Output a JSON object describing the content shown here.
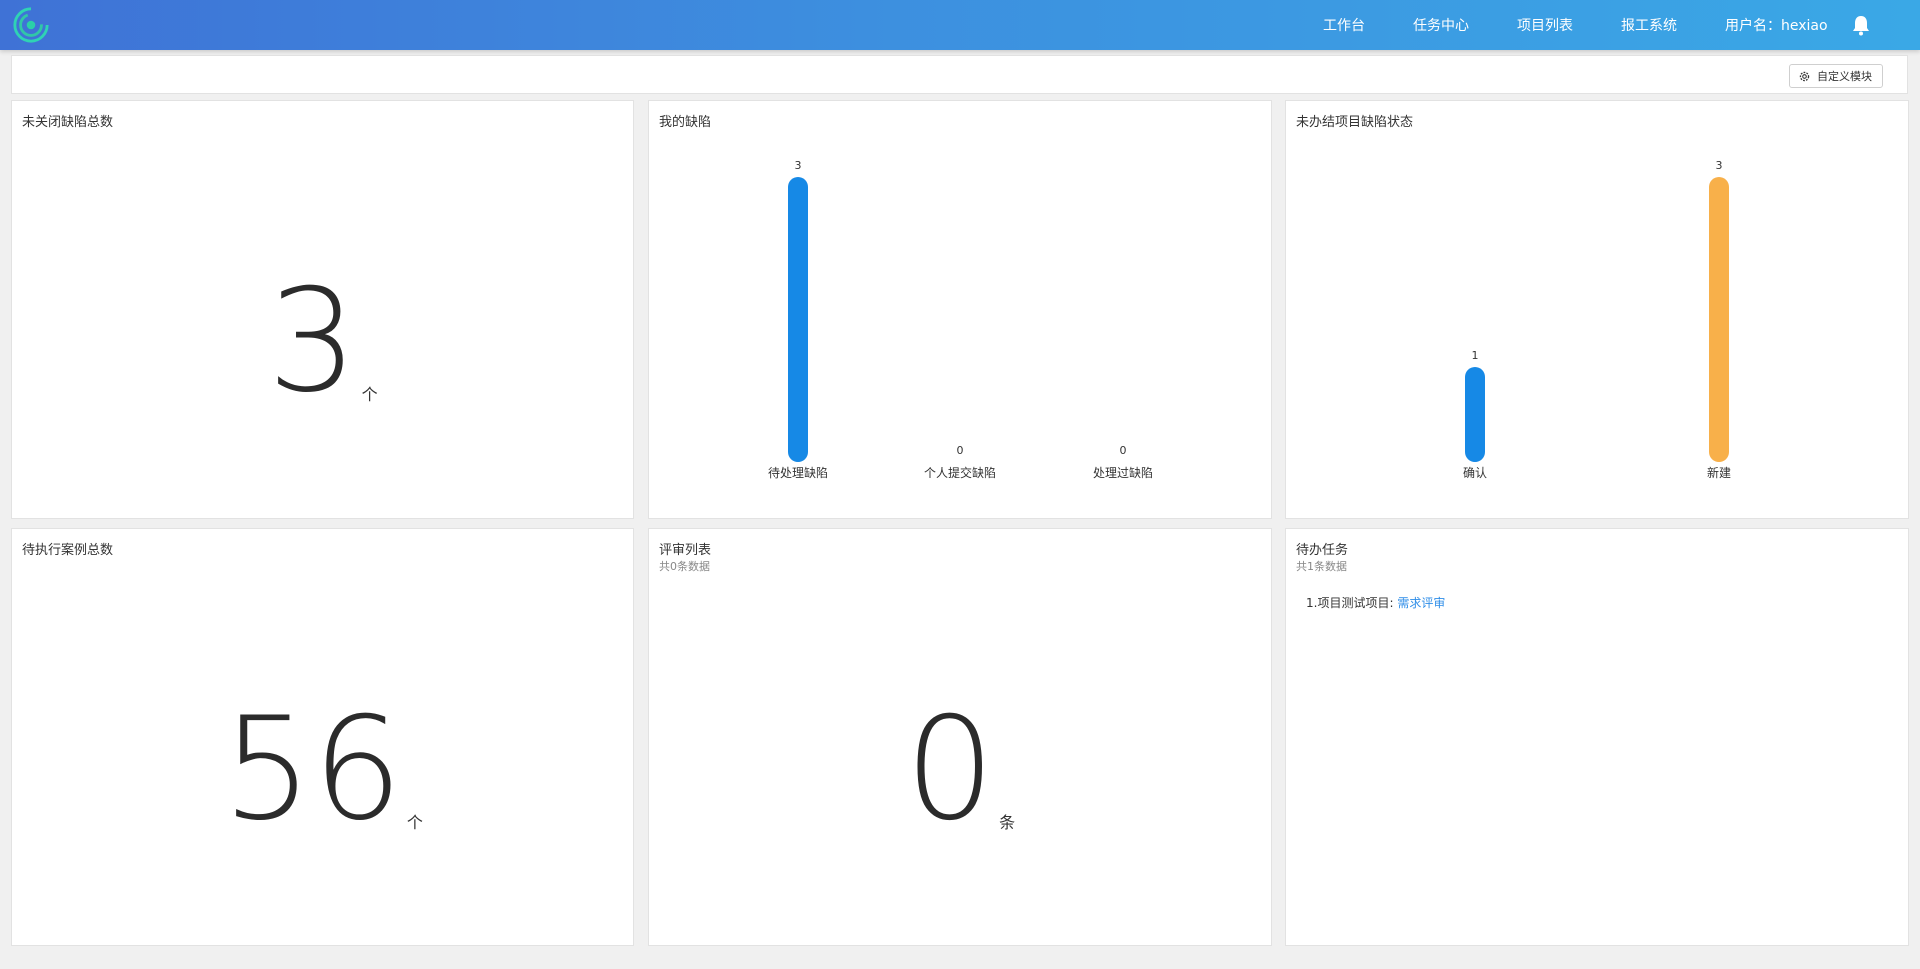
{
  "header": {
    "nav": [
      "工作台",
      "任务中心",
      "项目列表",
      "报工系统"
    ],
    "user_label": "用户名：hexiao",
    "icons": {
      "logo": "swirl-logo",
      "bell": "bell-icon"
    }
  },
  "toolbar": {
    "custom_button_label": "自定义模块",
    "custom_button_icon": "gear-icon"
  },
  "panels": {
    "unclosed_defects": {
      "title": "未关闭缺陷总数",
      "value": "3",
      "unit": "个"
    },
    "my_defects": {
      "title": "我的缺陷"
    },
    "project_defect_status": {
      "title": "未办结项目缺陷状态"
    },
    "pending_cases": {
      "title": "待执行案例总数",
      "value": "56",
      "unit": "个"
    },
    "review_list": {
      "title": "评审列表",
      "subtitle": "共0条数据",
      "value": "0",
      "unit": "条"
    },
    "todo_tasks": {
      "title": "待办任务",
      "subtitle": "共1条数据",
      "items": [
        {
          "prefix": "1.项目测试项目: ",
          "link": "需求评审"
        }
      ]
    }
  },
  "chart_data": [
    {
      "type": "bar",
      "categories": [
        "待处理缺陷",
        "个人提交缺陷",
        "处理过缺陷"
      ],
      "values": [
        3,
        0,
        0
      ],
      "colors": [
        "#1689e6",
        "#1689e6",
        "#1689e6"
      ],
      "ylim": [
        0,
        3
      ]
    },
    {
      "type": "bar",
      "categories": [
        "确认",
        "新建"
      ],
      "values": [
        1,
        3
      ],
      "colors": [
        "#1689e6",
        "#f8b04a"
      ],
      "ylim": [
        0,
        3
      ]
    }
  ]
}
